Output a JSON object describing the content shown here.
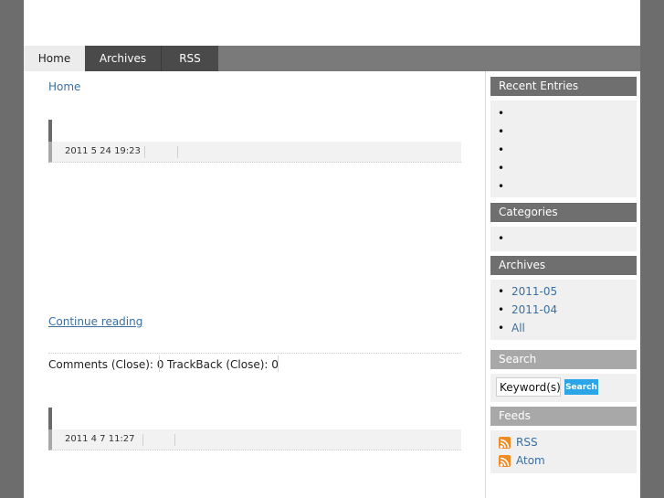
{
  "nav": {
    "home": "Home",
    "archives": "Archives",
    "rss": "RSS"
  },
  "breadcrumb": "Home",
  "entries": [
    {
      "date": "2011 5 24  19:23",
      "continue": "Continue reading",
      "comments": "Comments (Close): 0",
      "trackback": "TrackBack (Close): 0"
    },
    {
      "date": "2011 4  7  11:27"
    }
  ],
  "sidebar": {
    "recent_entries": {
      "title": "Recent Entries"
    },
    "categories": {
      "title": "Categories"
    },
    "archives": {
      "title": "Archives",
      "items": [
        "2011-05",
        "2011-04",
        "All"
      ]
    },
    "search": {
      "title": "Search",
      "input_value": "Keyword(s)",
      "button": "Search"
    },
    "feeds": {
      "title": "Feeds",
      "items": [
        "RSS",
        "Atom"
      ]
    }
  },
  "colors": {
    "nav_active": "#ececec",
    "nav_dark": "#4a4a4a",
    "link": "#3b6fa0",
    "search_button": "#2aa6e8",
    "feed_icon": "#f08a23"
  }
}
